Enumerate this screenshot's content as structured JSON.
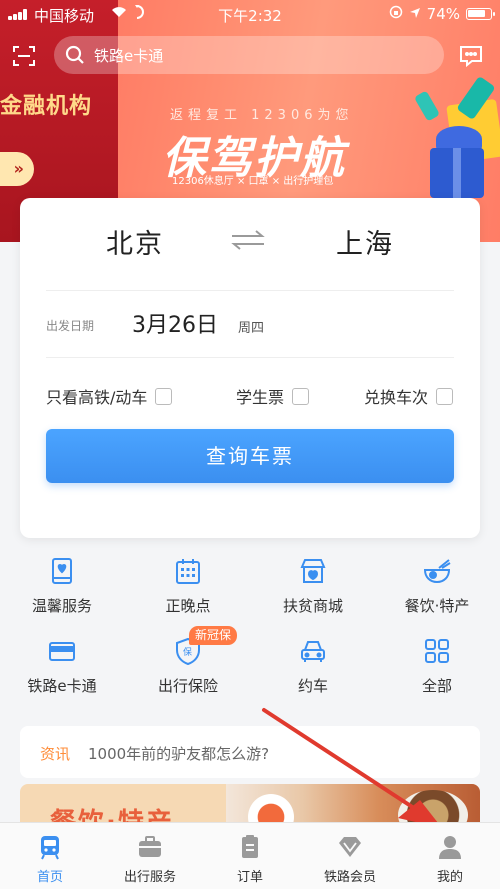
{
  "status_bar": {
    "carrier": "中国移动",
    "time": "下午2:32",
    "battery": "74%"
  },
  "search": {
    "placeholder": "铁路e卡通"
  },
  "banner": {
    "left_title": "金融机构",
    "left_button": "»",
    "subtitle": "返程复工 12306为您",
    "title": "保驾护航",
    "caption": "12306休息厅 × 口罩 × 出行护理包"
  },
  "booking": {
    "from_station": "北京",
    "to_station": "上海",
    "date_label": "出发日期",
    "date_value": "3月26日",
    "weekday": "周四",
    "options": [
      {
        "label": "只看高铁/动车",
        "checked": false
      },
      {
        "label": "学生票",
        "checked": false
      },
      {
        "label": "兑换车次",
        "checked": false
      }
    ],
    "query_button": "查询车票"
  },
  "services": [
    {
      "label": "温馨服务",
      "icon": "gift-box-icon"
    },
    {
      "label": "正晚点",
      "icon": "calendar-grid-icon"
    },
    {
      "label": "扶贫商城",
      "icon": "store-icon"
    },
    {
      "label": "餐饮·特产",
      "icon": "noodle-bowl-icon"
    },
    {
      "label": "铁路e卡通",
      "icon": "card-icon"
    },
    {
      "label": "出行保险",
      "icon": "shield-icon",
      "badge": "新冠保"
    },
    {
      "label": "约车",
      "icon": "car-icon"
    },
    {
      "label": "全部",
      "icon": "grid-icon"
    }
  ],
  "news": {
    "tag": "资讯",
    "text": "1000年前的驴友都怎么游?"
  },
  "promo": {
    "title": "餐饮·特产"
  },
  "tabbar": [
    {
      "label": "首页",
      "icon": "train-icon",
      "active": true
    },
    {
      "label": "出行服务",
      "icon": "briefcase-icon",
      "active": false
    },
    {
      "label": "订单",
      "icon": "order-icon",
      "active": false
    },
    {
      "label": "铁路会员",
      "icon": "diamond-icon",
      "active": false
    },
    {
      "label": "我的",
      "icon": "user-icon",
      "active": false
    }
  ],
  "colors": {
    "accent": "#3b8ff0",
    "news_tag": "#ff8c38",
    "badge": "#ff7a45",
    "annotation_arrow": "#e03a2e"
  }
}
